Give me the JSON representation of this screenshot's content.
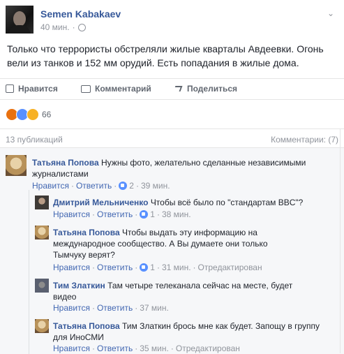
{
  "post": {
    "author": "Semen Kabakaev",
    "time": "40 мин.",
    "dot": "·",
    "text": "Только что террористы обстреляли жилые кварталы Авдеевки. Огонь вели из танков и 152 мм орудий. Есть попадания в жилые дома."
  },
  "actions": {
    "like": "Нравится",
    "comment": "Комментарий",
    "share": "Поделиться"
  },
  "reactions": {
    "count": "66",
    "types": [
      "angry",
      "like",
      "sad"
    ]
  },
  "comments_header": {
    "publications": "13 публикаций",
    "comments": "Комментарии: (7)"
  },
  "comments": [
    {
      "author": "Татьяна Попова",
      "text": "Нужны фото, желательно сделанные независимыми журналистами",
      "like": "Нравится",
      "reply": "Ответить",
      "likes": "2",
      "time": "39 мин.",
      "edited": ""
    },
    {
      "author": "Дмитрий Мельниченко",
      "text": "Чтобы всё было по \"стандартам BBC\"?",
      "like": "Нравится",
      "reply": "Ответить",
      "likes": "1",
      "time": "38 мин.",
      "edited": ""
    },
    {
      "author": "Татьяна Попова",
      "text": "Чтобы выдать эту информацию на международное сообщество. А Вы думаете они только Тымчуку верят?",
      "like": "Нравится",
      "reply": "Ответить",
      "likes": "1",
      "time": "31 мин.",
      "edited": "Отредактирован"
    },
    {
      "author": "Тим Златкин",
      "text": "Там четыре телеканала сейчас на месте, будет видео",
      "like": "Нравится",
      "reply": "Ответить",
      "likes": "",
      "time": "37 мин.",
      "edited": ""
    },
    {
      "author": "Татьяна Попова",
      "text": "Тим Златкин брось мне как будет. Запощу в группу для ИноСМИ",
      "like": "Нравится",
      "reply": "Ответить",
      "likes": "",
      "time": "35 мин.",
      "edited": "Отредактирован"
    }
  ]
}
